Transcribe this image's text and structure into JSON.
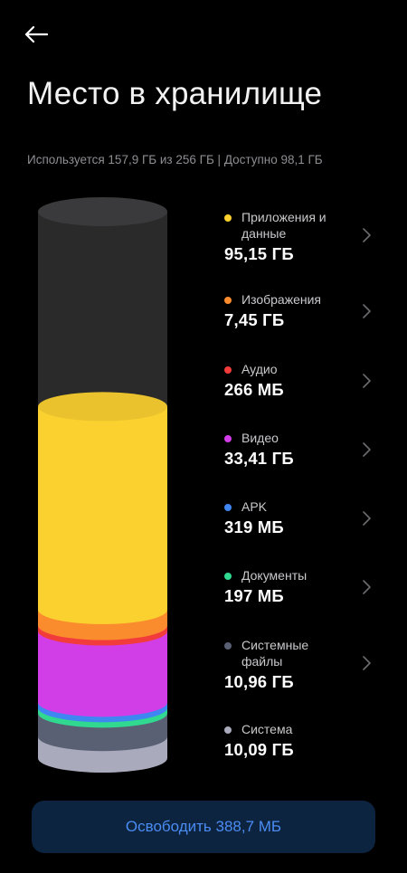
{
  "header": {
    "back_icon": "arrow-left-icon",
    "title": "Место в хранилище"
  },
  "summary": {
    "text": "Используется 157,9 ГБ из 256 ГБ | Доступно 98,1 ГБ"
  },
  "storage": {
    "total_gb": 256,
    "used_gb": 157.9,
    "available_gb": 98.1
  },
  "categories": [
    {
      "name": "Приложения и данные",
      "size": "95,15 ГБ",
      "color": "#fbd130",
      "has_chevron": true
    },
    {
      "name": "Изображения",
      "size": "7,45 ГБ",
      "color": "#fb8c2e",
      "has_chevron": true
    },
    {
      "name": "Аудио",
      "size": "266 МБ",
      "color": "#f23c3c",
      "has_chevron": true
    },
    {
      "name": "Видео",
      "size": "33,41 ГБ",
      "color": "#d13ee8",
      "has_chevron": true
    },
    {
      "name": "APK",
      "size": "319 МБ",
      "color": "#3f86f2",
      "has_chevron": true
    },
    {
      "name": "Документы",
      "size": "197 МБ",
      "color": "#30d98f",
      "has_chevron": true
    },
    {
      "name": "Системные файлы",
      "size": "10,96 ГБ",
      "color": "#5a6074",
      "has_chevron": true
    },
    {
      "name": "Система",
      "size": "10,09 ГБ",
      "color": "#a9abbd",
      "has_chevron": false
    }
  ],
  "free_button": {
    "label": "Освободить 388,7 МБ"
  }
}
